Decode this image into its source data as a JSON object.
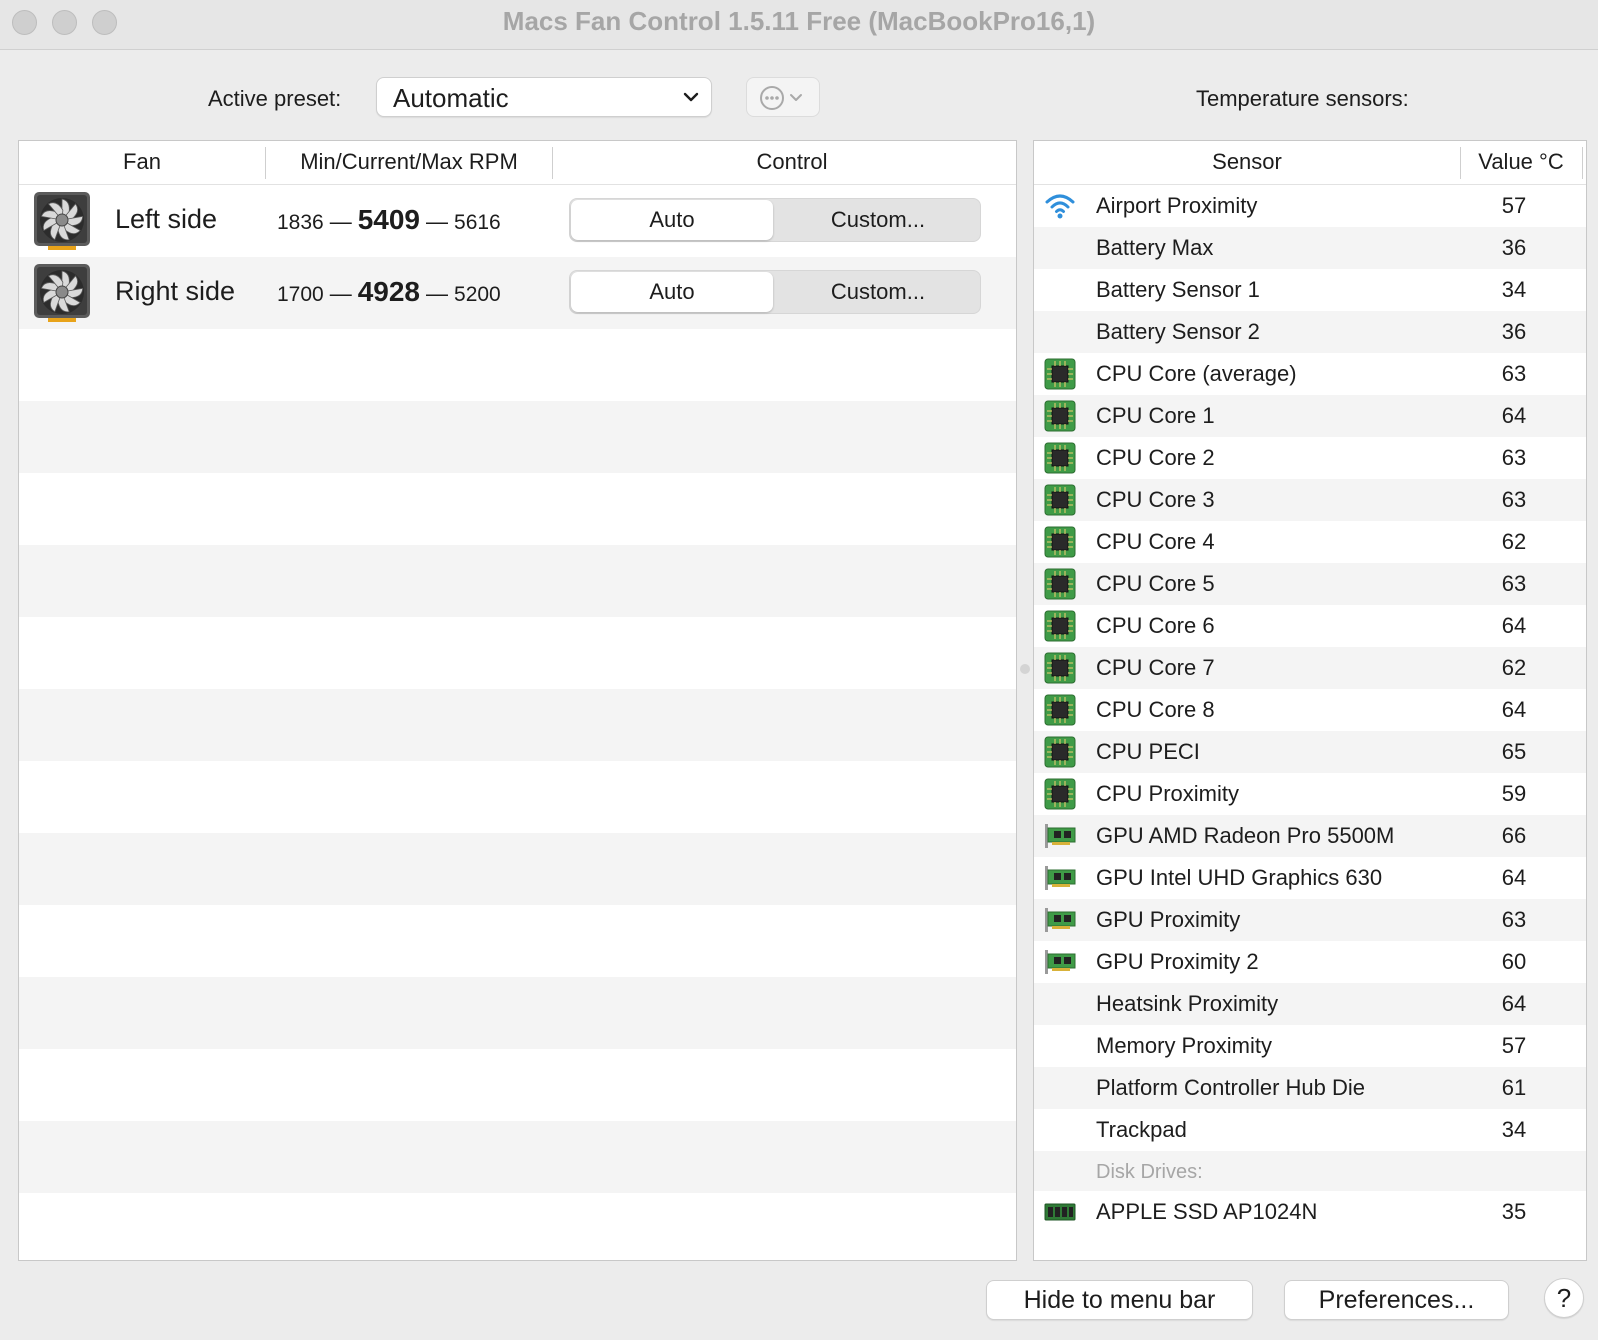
{
  "window": {
    "title": "Macs Fan Control 1.5.11 Free (MacBookPro16,1)"
  },
  "toolbar": {
    "preset_label": "Active preset:",
    "preset_value": "Automatic",
    "sensors_label": "Temperature sensors:"
  },
  "fan_table": {
    "headers": {
      "fan": "Fan",
      "rpm": "Min/Current/Max RPM",
      "control": "Control"
    },
    "rows": [
      {
        "name": "Left side",
        "min": "1836",
        "current": "5409",
        "max": "5616",
        "auto_label": "Auto",
        "custom_label": "Custom...",
        "mode": "Auto"
      },
      {
        "name": "Right side",
        "min": "1700",
        "current": "4928",
        "max": "5200",
        "auto_label": "Auto",
        "custom_label": "Custom...",
        "mode": "Auto"
      }
    ],
    "dash": "—"
  },
  "sensor_table": {
    "headers": {
      "sensor": "Sensor",
      "value": "Value °C"
    },
    "rows": [
      {
        "icon": "wifi-icon",
        "name": "Airport Proximity",
        "value": "57"
      },
      {
        "icon": "",
        "name": "Battery Max",
        "value": "36"
      },
      {
        "icon": "",
        "name": "Battery Sensor 1",
        "value": "34"
      },
      {
        "icon": "",
        "name": "Battery Sensor 2",
        "value": "36"
      },
      {
        "icon": "cpu-chip-icon",
        "name": "CPU Core (average)",
        "value": "63"
      },
      {
        "icon": "cpu-chip-icon",
        "name": "CPU Core 1",
        "value": "64"
      },
      {
        "icon": "cpu-chip-icon",
        "name": "CPU Core 2",
        "value": "63"
      },
      {
        "icon": "cpu-chip-icon",
        "name": "CPU Core 3",
        "value": "63"
      },
      {
        "icon": "cpu-chip-icon",
        "name": "CPU Core 4",
        "value": "62"
      },
      {
        "icon": "cpu-chip-icon",
        "name": "CPU Core 5",
        "value": "63"
      },
      {
        "icon": "cpu-chip-icon",
        "name": "CPU Core 6",
        "value": "64"
      },
      {
        "icon": "cpu-chip-icon",
        "name": "CPU Core 7",
        "value": "62"
      },
      {
        "icon": "cpu-chip-icon",
        "name": "CPU Core 8",
        "value": "64"
      },
      {
        "icon": "cpu-chip-icon",
        "name": "CPU PECI",
        "value": "65"
      },
      {
        "icon": "cpu-chip-icon",
        "name": "CPU Proximity",
        "value": "59"
      },
      {
        "icon": "gpu-card-icon",
        "name": "GPU AMD Radeon Pro 5500M",
        "value": "66"
      },
      {
        "icon": "gpu-card-icon",
        "name": "GPU Intel UHD Graphics 630",
        "value": "64"
      },
      {
        "icon": "gpu-card-icon",
        "name": "GPU Proximity",
        "value": "63"
      },
      {
        "icon": "gpu-card-icon",
        "name": "GPU Proximity 2",
        "value": "60"
      },
      {
        "icon": "",
        "name": "Heatsink Proximity",
        "value": "64"
      },
      {
        "icon": "",
        "name": "Memory Proximity",
        "value": "57"
      },
      {
        "icon": "",
        "name": "Platform Controller Hub Die",
        "value": "61"
      },
      {
        "icon": "",
        "name": "Trackpad",
        "value": "34"
      }
    ],
    "group_label": "Disk Drives:",
    "disk_rows": [
      {
        "icon": "ssd-icon",
        "name": "APPLE SSD AP1024N",
        "value": "35"
      }
    ]
  },
  "footer": {
    "hide_label": "Hide to menu bar",
    "prefs_label": "Preferences...",
    "help_label": "?"
  },
  "colors": {
    "accent_icon_blue": "#2f8fdb",
    "chip_green": "#3f9b47",
    "stripe": "#f4f4f4"
  }
}
